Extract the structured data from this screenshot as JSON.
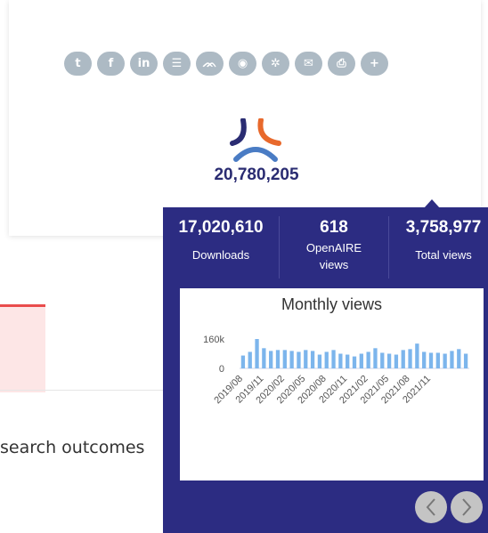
{
  "share_buttons": [
    {
      "icon": "twitter-icon",
      "glyph": "t"
    },
    {
      "icon": "facebook-icon",
      "glyph": "f"
    },
    {
      "icon": "linkedin-icon",
      "glyph": "in"
    },
    {
      "icon": "list-icon",
      "glyph": "☰"
    },
    {
      "icon": "mendeley-icon",
      "glyph": "ᨏ"
    },
    {
      "icon": "reddit-icon",
      "glyph": "◉"
    },
    {
      "icon": "settings-icon",
      "glyph": "✲"
    },
    {
      "icon": "email-icon",
      "glyph": "✉"
    },
    {
      "icon": "print-icon",
      "glyph": "⎙"
    },
    {
      "icon": "plus-icon",
      "glyph": "+"
    }
  ],
  "total_count": "20,780,205",
  "search_text": "search outcomes",
  "popup": {
    "stats": [
      {
        "value": "17,020,610",
        "label": "Downloads"
      },
      {
        "value": "618",
        "label": "OpenAIRE views"
      },
      {
        "value": "3,758,977",
        "label": "Total views"
      }
    ]
  },
  "colors": {
    "popup_bg": "#2c2c82",
    "bar": "#7cb5ec",
    "logo_blue": "#2a2c72",
    "logo_orange": "#e8692c"
  },
  "chart_data": {
    "type": "bar",
    "title": "Monthly views",
    "yticks": [
      "160k",
      "0"
    ],
    "ylim": [
      0,
      160000
    ],
    "xticklabels": [
      "2019/08",
      "2019/11",
      "2020/02",
      "2020/05",
      "2020/08",
      "2020/11",
      "2021/02",
      "2021/05",
      "2021/08",
      "2021/11"
    ],
    "values": [
      70000,
      90000,
      160000,
      110000,
      95000,
      100000,
      100000,
      95000,
      90000,
      100000,
      95000,
      75000,
      90000,
      100000,
      80000,
      75000,
      65000,
      80000,
      90000,
      110000,
      85000,
      80000,
      75000,
      100000,
      105000,
      135000,
      90000,
      85000,
      85000,
      80000,
      95000,
      105000,
      80000
    ]
  }
}
